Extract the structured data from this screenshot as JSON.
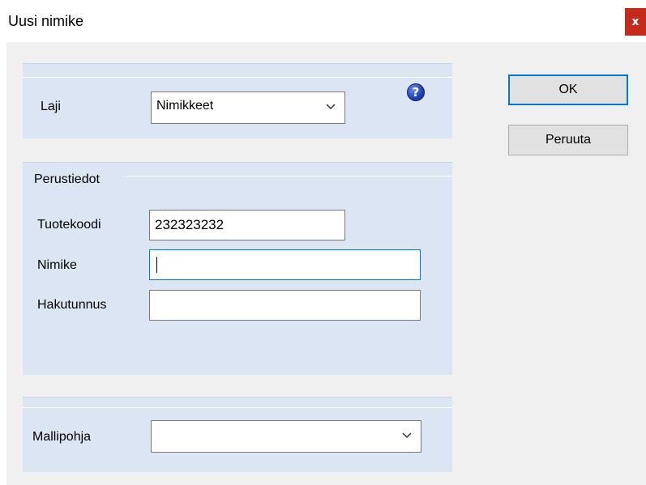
{
  "window": {
    "title": "Uusi nimike",
    "close_label": "x"
  },
  "laji": {
    "label": "Laji",
    "selected": "Nimikkeet",
    "help_label": "?"
  },
  "perustiedot": {
    "group_label": "Perustiedot",
    "tuotekoodi_label": "Tuotekoodi",
    "tuotekoodi_value": "232323232",
    "nimike_label": "Nimike",
    "nimike_value": "",
    "hakutunnus_label": "Hakutunnus",
    "hakutunnus_value": ""
  },
  "mallipohja": {
    "label": "Mallipohja",
    "selected": ""
  },
  "buttons": {
    "ok_label": "OK",
    "cancel_label": "Peruuta"
  },
  "colors": {
    "panel": "#dbe5f4",
    "focus_border": "#0078d7",
    "close": "#c42b1c"
  }
}
